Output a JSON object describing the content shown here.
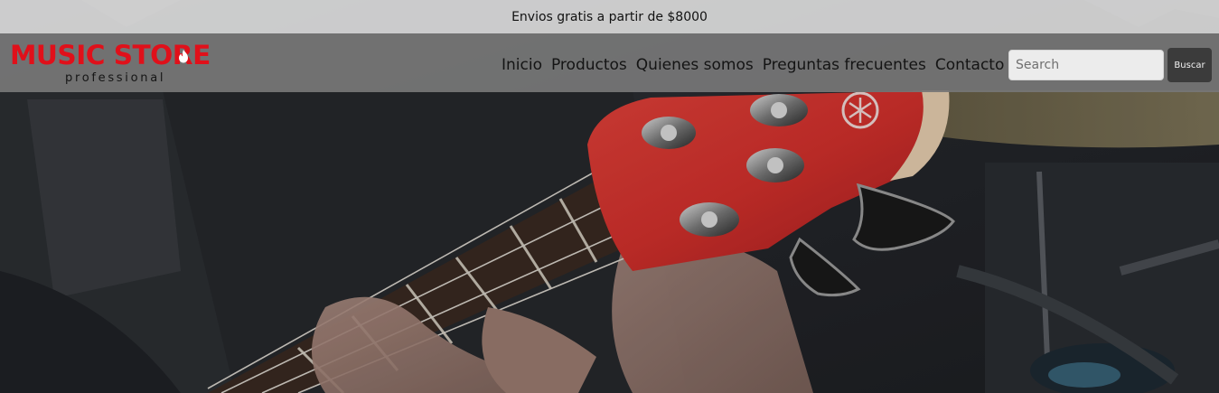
{
  "promo": {
    "text": "Envios gratis a partir de $8000"
  },
  "brand": {
    "name": "MUSIC STORE",
    "tagline": "professional",
    "color": "#e0101a"
  },
  "nav": {
    "items": [
      {
        "label": "Inicio"
      },
      {
        "label": "Productos"
      },
      {
        "label": "Quienes somos"
      },
      {
        "label": "Preguntas frecuentes"
      },
      {
        "label": "Contacto"
      }
    ]
  },
  "search": {
    "placeholder": "Search",
    "value": "",
    "button_label": "Buscar"
  },
  "hero": {
    "image_subject": "bass guitar headstock",
    "headstock_color": "#d8322f"
  }
}
